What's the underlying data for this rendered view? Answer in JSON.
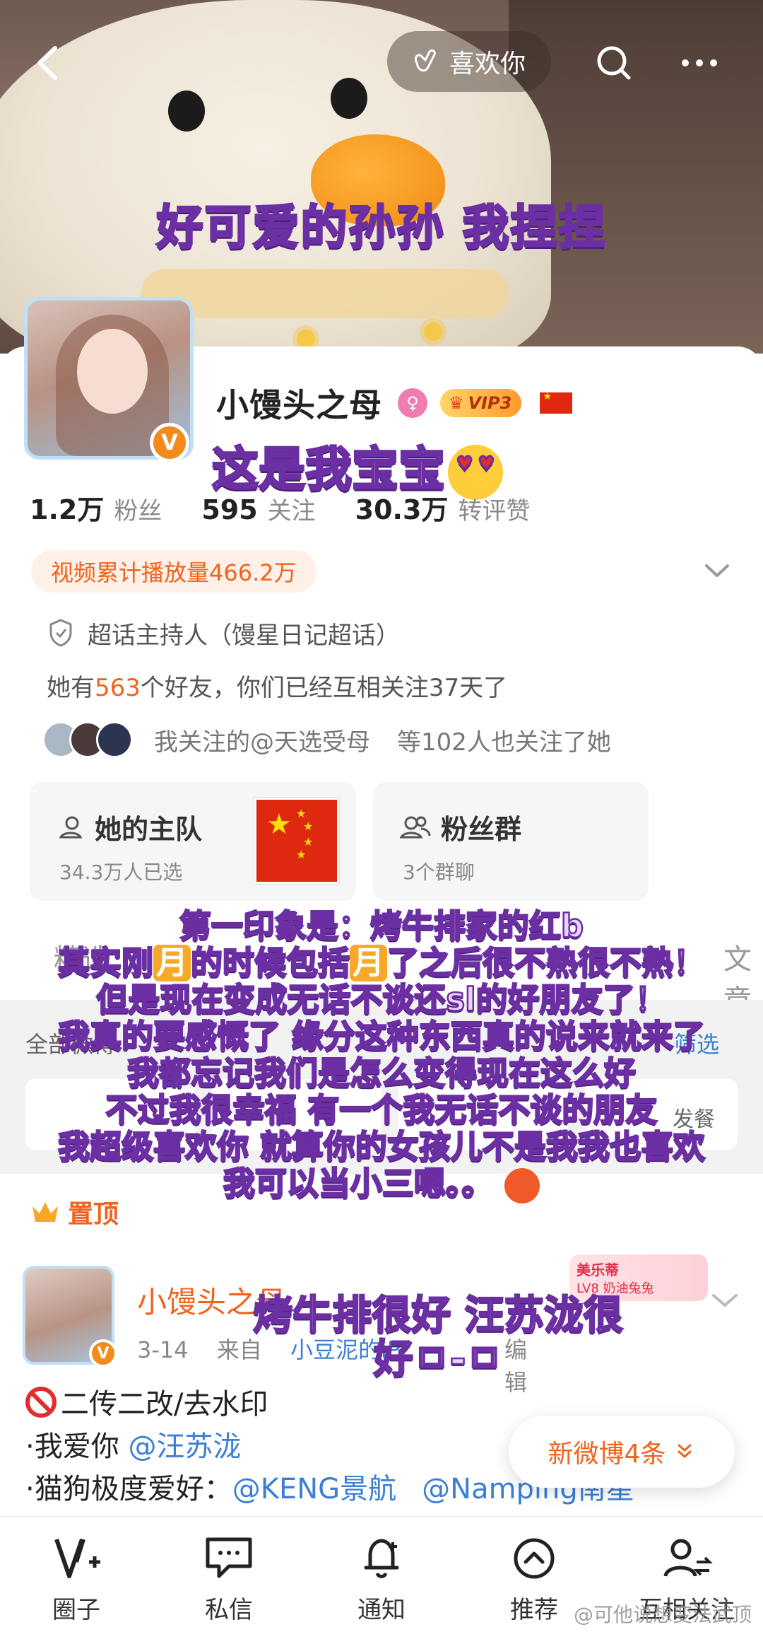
{
  "cover": {
    "caption": "好可爱的孙孙 我捏捏",
    "like_label": "喜欢你"
  },
  "profile": {
    "name": "小馒头之母",
    "vip_label": "VIP3",
    "sticker_caption": "这是我宝宝",
    "stats": [
      {
        "value": "1.2万",
        "label": "粉丝"
      },
      {
        "value": "595",
        "label": "关注"
      },
      {
        "value": "30.3万",
        "label": "转评赞"
      }
    ],
    "play_count": "视频累计播放量466.2万",
    "host_text": "超话主持人（馒星日记超话）",
    "friends_prefix": "她有",
    "friends_count": "563",
    "friends_suffix": "个好友，你们已经互相关注37天了",
    "mutual_text": "我关注的@天选受母",
    "mutual_suffix": "等102人也关注了她"
  },
  "tiles": [
    {
      "title": "她的主队",
      "sub": "34.3万人已选"
    },
    {
      "title": "粉丝群",
      "sub": "3个群聊"
    }
  ],
  "tabs": {
    "first": "精选",
    "last": "文章"
  },
  "filter": {
    "all": "全部微博",
    "filter": "筛选",
    "chip_partial": "发餐"
  },
  "overlay_caption": {
    "l1": "第一印象是：烤牛排家的红b",
    "l2a": "其实刚",
    "l2m1": "月",
    "l2b": "的时候包括",
    "l2m2": "月",
    "l2c": "了之后很不熟很不熟！",
    "l3": "但是现在变成无话不谈还sl的好朋友了！",
    "l4": "我真的要感慨了 缘分这种东西真的说来就来了",
    "l5": "我都忘记我们是怎么变得现在这么好",
    "l6": "不过我很幸福 有一个我无话不谈的朋友",
    "l7": "我超级喜欢你 就算你的女孩儿不是我我也喜欢",
    "l8": "我可以当小三嗯。。"
  },
  "pinned_label": "置顶",
  "post": {
    "author": "小馒头之母",
    "date": "3-14",
    "from": "来自",
    "source": "小豆泥的iP",
    "edited": "编辑",
    "medal_title": "美乐蒂",
    "medal_sub": "LV8 奶油兔兔",
    "sticker_caption_1": "烤牛排很好 汪苏泷很",
    "sticker_caption_2": "好ㅁ-ㅁ",
    "line1": "二传二改/去水印",
    "line2_prefix": "·我爱你",
    "line2_link": "@汪苏泷",
    "line3_prefix": "·猫狗极度爱好：",
    "line3_link1": "@KENG景航",
    "line3_link2": "@Namping南星"
  },
  "new_posts": "新微博4条",
  "nav": [
    {
      "label": "圈子",
      "icon": "circle-icon"
    },
    {
      "label": "私信",
      "icon": "message-icon"
    },
    {
      "label": "通知",
      "icon": "bell-icon"
    },
    {
      "label": "推荐",
      "icon": "recommend-icon"
    },
    {
      "label": "互相关注",
      "icon": "mutual-follow-icon"
    }
  ],
  "watermark": "@可他说想变法武顶",
  "colors": {
    "accent": "#f2621b",
    "link": "#3b7fd4",
    "caption_fill": "#e9d5ff",
    "caption_stroke": "#6b2fa3"
  }
}
